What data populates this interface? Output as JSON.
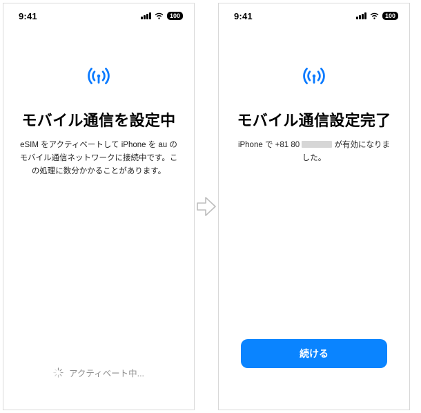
{
  "status": {
    "time": "9:41",
    "battery": "100"
  },
  "screen1": {
    "title": "モバイル通信を設定中",
    "body": "eSIM をアクティベートして iPhone を au のモバイル通信ネットワークに接続中です。この処理に数分かかることがあります。",
    "activating": "アクティベート中..."
  },
  "screen2": {
    "title": "モバイル通信設定完了",
    "prefix": "iPhone で +81 80",
    "suffix": "が有効になりました。",
    "cta": "続ける"
  }
}
